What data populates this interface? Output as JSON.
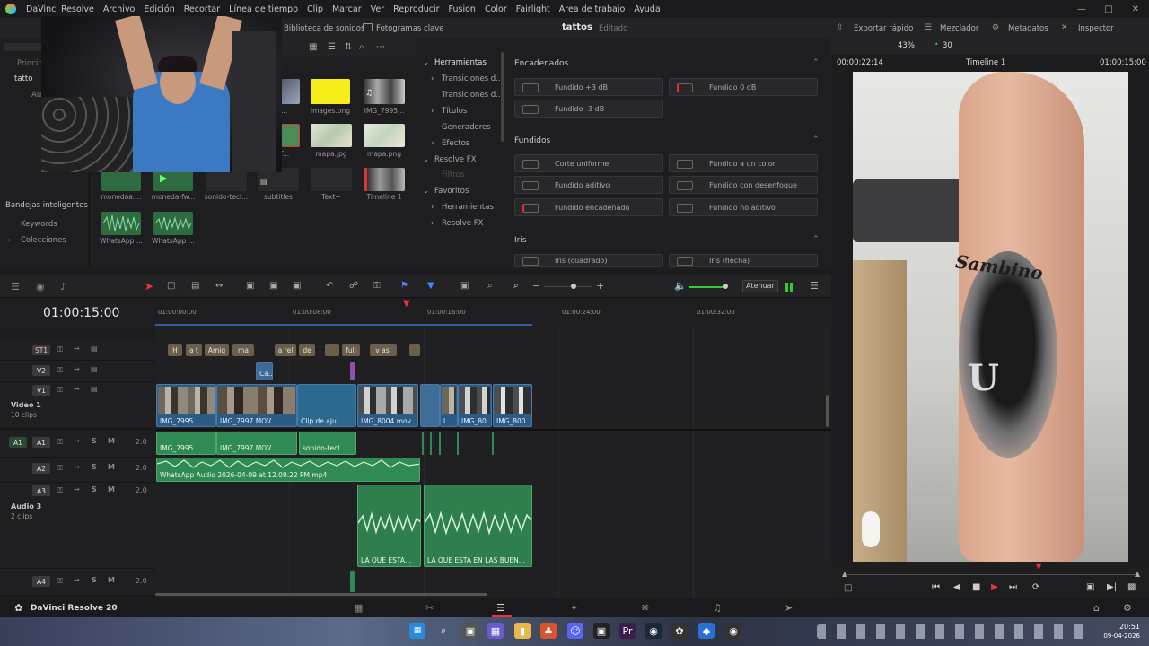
{
  "menubar": {
    "app_title": "DaVinci Resolve",
    "items": [
      "Archivo",
      "Edición",
      "Recortar",
      "Línea de tiempo",
      "Clip",
      "Marcar",
      "Ver",
      "Reproducir",
      "Fusion",
      "Color",
      "Fairlight",
      "Área de trabajo",
      "Ayuda"
    ]
  },
  "toolbar": {
    "media_pool_tab": "Biblioteca de sonidos",
    "keyframes_tab": "Fotogramas clave",
    "project_name": "tattos",
    "project_status": "Editado",
    "quick_export": "Exportar rápido",
    "mixer": "Mezclador",
    "metadata": "Metadatos",
    "inspector": "Inspector"
  },
  "viewer_bar": {
    "zoom": "43%",
    "fps": "30",
    "timecode_left": "00:00:22:14",
    "timeline_name": "Timeline 1",
    "timecode_right": "01:00:15:00"
  },
  "left_panel": {
    "principal": "Princip",
    "tattoos_bin": "tatto",
    "sub": "Au",
    "smart_bins": "Bandejas inteligentes",
    "keywords": "Keywords",
    "collections": "Colecciones"
  },
  "media_pool": {
    "items": [
      {
        "label": "de...",
        "kind": "image"
      },
      {
        "label": "images.png",
        "kind": "yellow"
      },
      {
        "label": "IMG_7995...",
        "kind": "video"
      },
      {
        "label": "EST...",
        "kind": "image"
      },
      {
        "label": "mapa.jpg",
        "kind": "map"
      },
      {
        "label": "mapa.png",
        "kind": "map"
      },
      {
        "label": "monedaa....",
        "kind": "audio"
      },
      {
        "label": "moneda-fw...",
        "kind": "audio"
      },
      {
        "label": "sonido-tecl...",
        "kind": "dark"
      },
      {
        "label": "subtitles",
        "kind": "dark"
      },
      {
        "label": "Text+",
        "kind": "dark"
      },
      {
        "label": "Timeline 1",
        "kind": "timeline"
      },
      {
        "label": "WhatsApp ...",
        "kind": "audio"
      },
      {
        "label": "WhatsApp ...",
        "kind": "audio"
      }
    ]
  },
  "effects_tree": {
    "header": "Herramientas",
    "items": [
      "Transiciones d...",
      "Transiciones d...",
      "Títulos",
      "Generadores",
      "Efectos",
      "Resolve FX",
      "Filtros",
      "Favoritos",
      "Herramientas",
      "Resolve FX"
    ]
  },
  "effects_panel": {
    "section_encadenados": "Encadenados",
    "btn_plus3": "Fundido +3 dB",
    "btn_0": "Fundido 0 dB",
    "btn_minus3": "Fundido -3 dB",
    "section_fundidos": "Fundidos",
    "corte": "Corte uniforme",
    "a_color": "Fundido a un color",
    "aditivo": "Fundido aditivo",
    "desenfoque": "Fundido con desenfoque",
    "encadenado": "Fundido encadenado",
    "no_aditivo": "Fundido no aditivo",
    "section_iris": "Iris",
    "iris_cuadrado": "Iris (cuadrado)",
    "iris_flecha": "Iris (flecha)"
  },
  "timeline": {
    "timecode": "01:00:15:00",
    "attenuate": "Atenuar",
    "ruler": [
      "01:00:00:00",
      "01:00:08:00",
      "01:00:16:00",
      "01:00:24:00",
      "01:00:32:00"
    ],
    "tracks": {
      "st1": "ST1",
      "v2": "V2",
      "v1": "V1",
      "video1_name": "Video 1",
      "video1_clips": "10 clips",
      "a1": "A1",
      "a2": "A2",
      "a3": "A3",
      "a4": "A4",
      "audio3_name": "Audio 3",
      "audio3_clips": "2 clips",
      "vol": "2.0"
    },
    "subtitles": [
      "H",
      "a t",
      "Amig",
      "ma",
      "a rel",
      "de",
      "",
      "full",
      "v asi",
      ""
    ],
    "v2_clip": "Ca...",
    "v1_clips": [
      "IMG_7995....",
      "IMG_7997.MOV",
      "Clip de aju...",
      "IMG_8004.mov",
      "I...",
      "IMG_80...",
      "IMG_800..."
    ],
    "a1_clips": [
      "IMG_7995....",
      "IMG_7997.MOV",
      "sonido-tecl..."
    ],
    "a2_clip": "WhatsApp Audio 2026-04-09 at 12.09.22 PM.mp4",
    "a3_clips": [
      "LA QUE ESTA...",
      "LA QUE ESTA EN LAS BUEN..."
    ]
  },
  "footer": {
    "brand": "DaVinci Resolve 20"
  },
  "taskbar": {
    "time": "20:51",
    "date": "09-04-2026"
  },
  "video_overlay": {
    "tattoo_text": "Sambino",
    "letter": "U"
  }
}
